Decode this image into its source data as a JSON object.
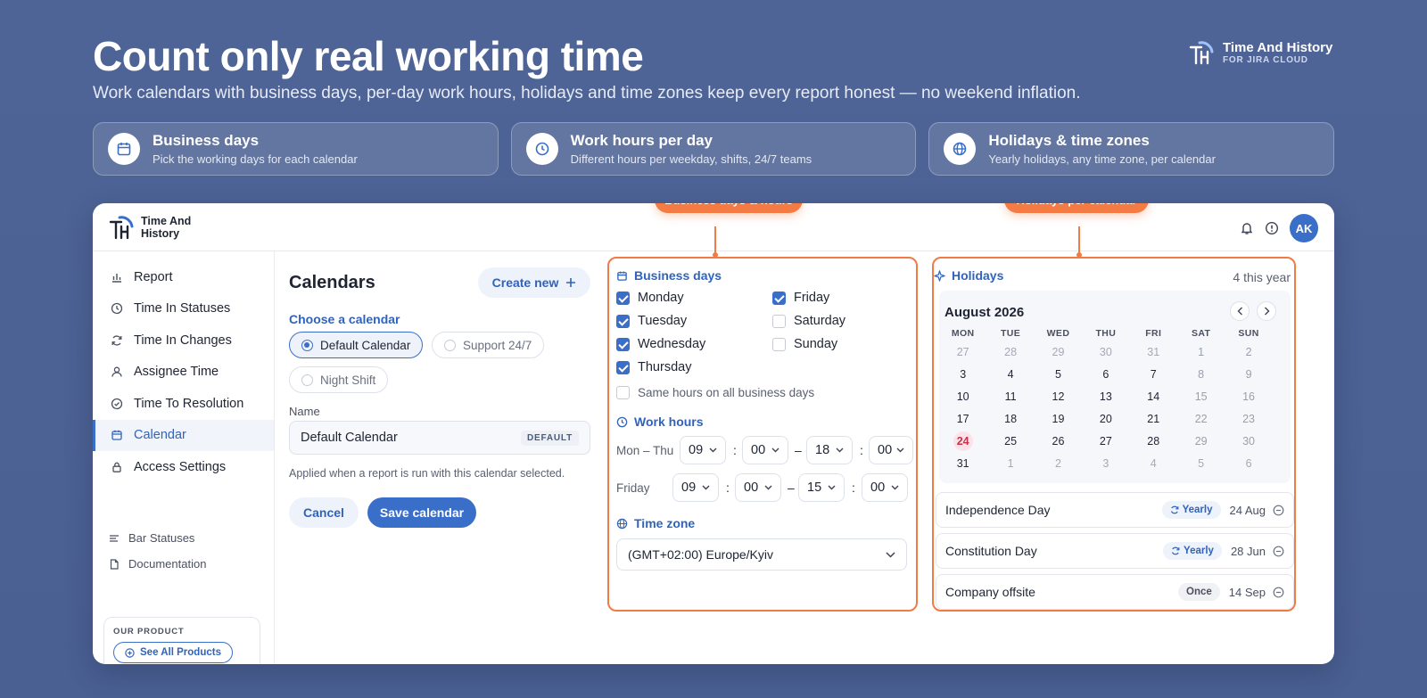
{
  "hero": {
    "title": "Count only real working time",
    "subtitle": "Work calendars with business days, per-day work hours, holidays and time zones keep every report honest — no weekend inflation."
  },
  "brand": {
    "name": "Time And History",
    "subtitle": "FOR JIRA CLOUD",
    "app_name": "Time And History"
  },
  "features": [
    {
      "icon": "calendar-icon",
      "title": "Business days",
      "desc": "Pick the working days for each calendar"
    },
    {
      "icon": "clock-icon",
      "title": "Work hours per day",
      "desc": "Different hours per weekday, shifts, 24/7 teams"
    },
    {
      "icon": "globe-icon",
      "title": "Holidays & time zones",
      "desc": "Yearly holidays, any time zone, per calendar"
    }
  ],
  "header": {
    "avatar": "AK"
  },
  "sidebar": {
    "items": [
      {
        "icon": "bar-chart-icon",
        "label": "Report"
      },
      {
        "icon": "clock-icon",
        "label": "Time In Statuses"
      },
      {
        "icon": "refresh-icon",
        "label": "Time In Changes"
      },
      {
        "icon": "user-icon",
        "label": "Assignee Time"
      },
      {
        "icon": "check-circle-icon",
        "label": "Time To Resolution"
      },
      {
        "icon": "calendar-icon",
        "label": "Calendar",
        "active": true
      },
      {
        "icon": "lock-icon",
        "label": "Access Settings"
      }
    ],
    "secondary": [
      {
        "icon": "list-icon",
        "label": "Bar Statuses"
      },
      {
        "icon": "document-icon",
        "label": "Documentation"
      }
    ],
    "our_product_label": "OUR PRODUCT",
    "see_all": "See All Products"
  },
  "form": {
    "title": "Calendars",
    "create_new": "Create new",
    "choose_label": "Choose a calendar",
    "calendars": [
      {
        "label": "Default Calendar",
        "selected": true
      },
      {
        "label": "Support 24/7",
        "selected": false
      },
      {
        "label": "Night Shift",
        "selected": false
      }
    ],
    "name_label": "Name",
    "name_value": "Default Calendar",
    "name_badge": "DEFAULT",
    "help": "Applied when a report is run with this calendar selected.",
    "cancel": "Cancel",
    "save": "Save calendar"
  },
  "callouts": {
    "left": "Business days & hours",
    "right": "Holidays per calendar"
  },
  "business": {
    "title": "Business days",
    "days": [
      {
        "label": "Monday",
        "checked": true
      },
      {
        "label": "Tuesday",
        "checked": true
      },
      {
        "label": "Wednesday",
        "checked": true
      },
      {
        "label": "Thursday",
        "checked": true
      },
      {
        "label": "Friday",
        "checked": true
      },
      {
        "label": "Saturday",
        "checked": false
      },
      {
        "label": "Sunday",
        "checked": false
      }
    ],
    "same_hours": "Same hours on all business days",
    "same_hours_checked": false,
    "work_hours_title": "Work hours",
    "rows": [
      {
        "label": "Mon – Thu",
        "start_h": "09",
        "start_m": "00",
        "end_h": "18",
        "end_m": "00"
      },
      {
        "label": "Friday",
        "start_h": "09",
        "start_m": "00",
        "end_h": "15",
        "end_m": "00"
      }
    ],
    "timezone_title": "Time zone",
    "timezone": "(GMT+02:00) Europe/Kyiv"
  },
  "holidays": {
    "title": "Holidays",
    "count": "4 this year",
    "month": "August 2026",
    "weekdays": [
      "MON",
      "TUE",
      "WED",
      "THU",
      "FRI",
      "SAT",
      "SUN"
    ],
    "weeks": [
      [
        "27",
        "28",
        "29",
        "30",
        "31",
        "1",
        "2"
      ],
      [
        "3",
        "4",
        "5",
        "6",
        "7",
        "8",
        "9"
      ],
      [
        "10",
        "11",
        "12",
        "13",
        "14",
        "15",
        "16"
      ],
      [
        "17",
        "18",
        "19",
        "20",
        "21",
        "22",
        "23"
      ],
      [
        "24",
        "25",
        "26",
        "27",
        "28",
        "29",
        "30"
      ],
      [
        "31",
        "1",
        "2",
        "3",
        "4",
        "5",
        "6"
      ]
    ],
    "highlight_day": "24",
    "list": [
      {
        "name": "Independence Day",
        "freq": "Yearly",
        "date": "24 Aug"
      },
      {
        "name": "Constitution Day",
        "freq": "Yearly",
        "date": "28 Jun"
      },
      {
        "name": "Company offsite",
        "freq": "Once",
        "date": "14 Sep"
      }
    ]
  },
  "colors": {
    "accent": "#3a6fc9",
    "callout": "#f47b43",
    "background": "#4e6496"
  }
}
